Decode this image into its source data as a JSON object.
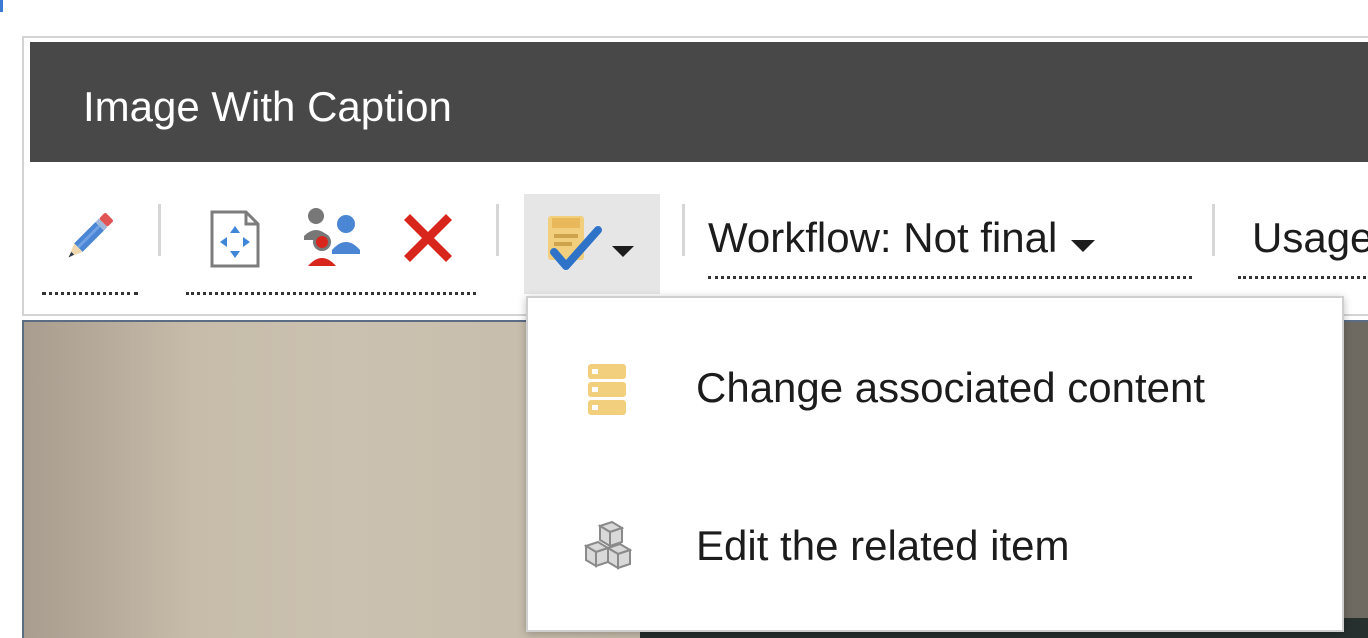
{
  "panel": {
    "title": "Image With Caption"
  },
  "toolbar": {
    "edit_icon": "pencil-icon",
    "resize_icon": "resize-frame-icon",
    "users_icon": "users-icon",
    "delete_icon": "delete-x-icon",
    "associated_icon": "checklist-icon",
    "workflow_label": "Workflow: Not final",
    "usage_label": "Usage"
  },
  "dropdown": {
    "items": [
      {
        "label": "Change associated content",
        "icon": "stack-icon"
      },
      {
        "label": "Edit the related item",
        "icon": "boxes-icon"
      }
    ]
  },
  "colors": {
    "header_bg": "#484848",
    "accent_red": "#d9261c",
    "accent_blue": "#3b7bd1",
    "folder_yellow": "#f2cf7c"
  }
}
